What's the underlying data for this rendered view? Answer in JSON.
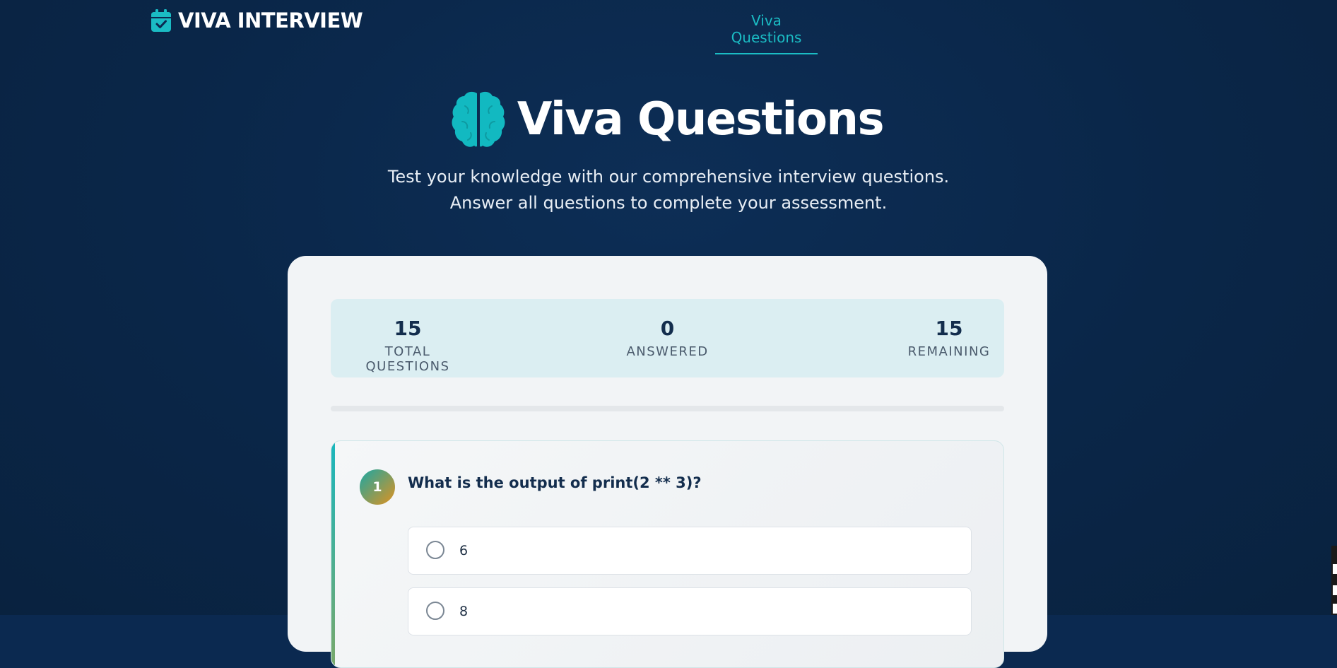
{
  "navbar": {
    "brand": "VIVA INTERVIEW",
    "brand_icon": "calendar-check-icon",
    "links": [
      {
        "label": "Viva Questions",
        "active": true
      }
    ]
  },
  "hero": {
    "icon": "brain-icon",
    "title": "Viva Questions",
    "subtitle_line1": "Test your knowledge with our comprehensive interview questions.",
    "subtitle_line2": "Answer all questions to complete your assessment."
  },
  "stats": {
    "total": {
      "value": "15",
      "label": "TOTAL QUESTIONS"
    },
    "answered": {
      "value": "0",
      "label": "ANSWERED"
    },
    "remaining": {
      "value": "15",
      "label": "REMAINING"
    }
  },
  "progress": {
    "fraction": 0
  },
  "question": {
    "number": "1",
    "text": "What is the output of print(2 ** 3)?",
    "options": [
      "6",
      "8"
    ]
  },
  "colors": {
    "background": "#0b2950",
    "accent": "#1bbcc4",
    "card": "#f2f4f6",
    "stats_bg": "#dbeef2"
  }
}
